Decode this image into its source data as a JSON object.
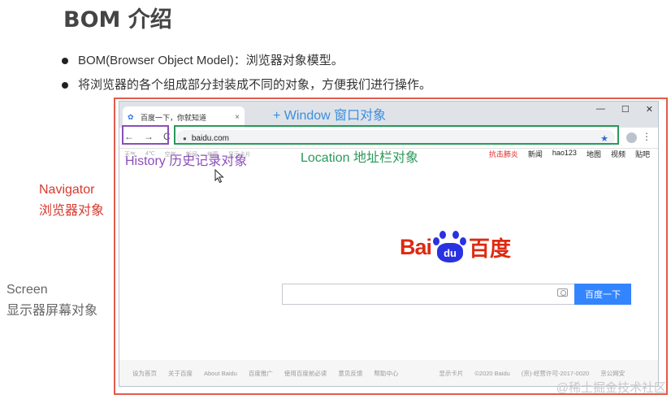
{
  "slide": {
    "title": "BOM 介绍",
    "bullets": [
      "BOM(Browser Object Model)：浏览器对象模型。",
      "将浏览器的各个组成部分封装成不同的对象，方便我们进行操作。"
    ],
    "navigator_label_en": "Navigator",
    "navigator_label_cn": "浏览器对象",
    "screen_label_en": "Screen",
    "screen_label_cn": "显示器屏幕对象"
  },
  "annotations": {
    "window": "+ Window 窗口对象",
    "location": "Location 地址栏对象",
    "history": "History 历史记录对象"
  },
  "browser": {
    "tab_title": "百度一下，你就知道",
    "tab_close": "×",
    "window_controls": [
      "—",
      "☐",
      "✕"
    ],
    "nav_buttons": [
      "←",
      "→",
      "C"
    ],
    "url": "baidu.com",
    "bookmarks": [
      "天气",
      "4℃",
      "空气",
      "新闻",
      "地图",
      "显示卡片"
    ],
    "baidu_nav": [
      "抗击肺炎",
      "新闻",
      "hao123",
      "地图",
      "视频",
      "贴吧"
    ],
    "logo_left": "Bai",
    "logo_paw": "du",
    "logo_right": "百度",
    "search_button": "百度一下",
    "footer_links": [
      "设为首页",
      "关于百度",
      "About Baidu",
      "百度推广",
      "使用百度前必读",
      "意见反馈",
      "帮助中心",
      "显示卡片",
      "©2020 Baidu",
      "(京)-经营许可-2017-0020",
      "京公网安"
    ]
  },
  "watermark": "@稀土掘金技术社区",
  "colors": {
    "red_frame": "#e25b4b",
    "window_annotation": "#3a8ee0",
    "location_annotation": "#2a9a5a",
    "history_annotation": "#8b4fb8",
    "baidu_red": "#de2910",
    "baidu_blue": "#2932e1",
    "search_button": "#3385ff"
  }
}
